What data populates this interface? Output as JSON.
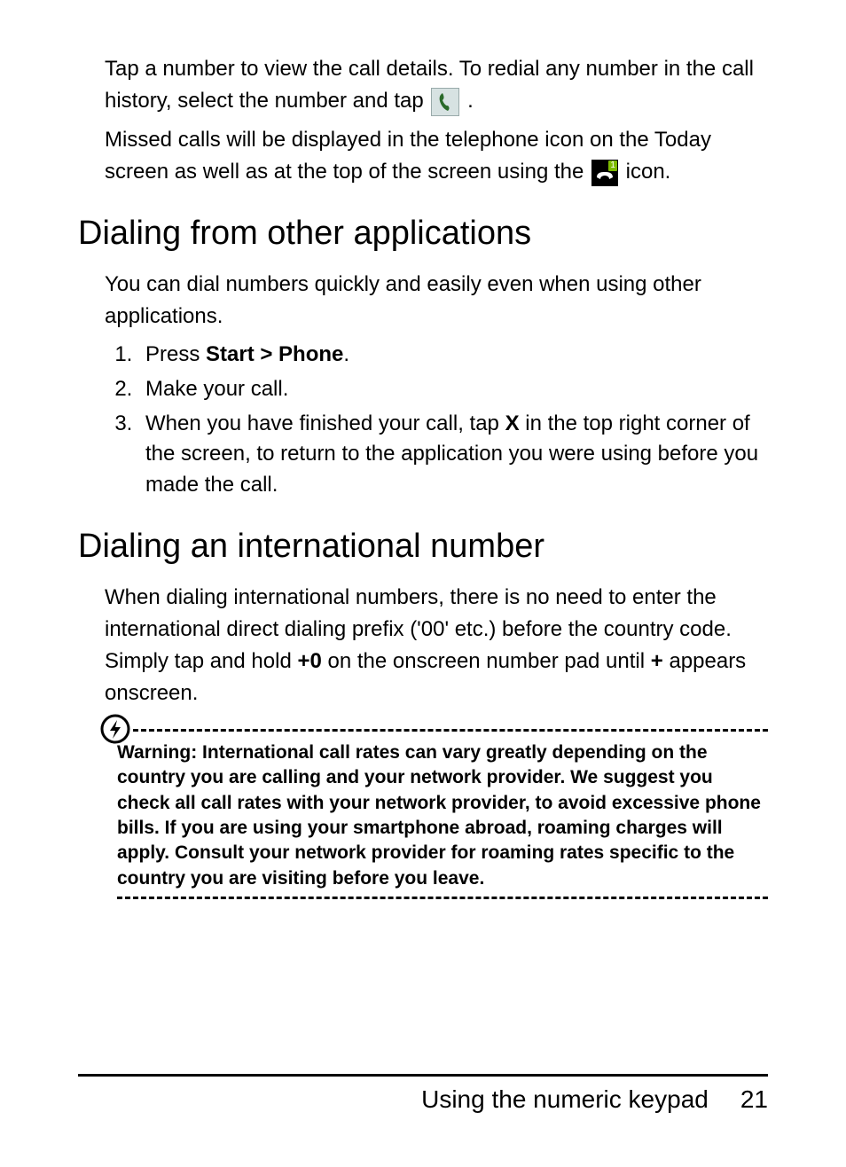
{
  "intro": {
    "p1a": "Tap a number to view the call details. To redial any number in the call history, select the number and tap ",
    "p1b": ".",
    "p2a": "Missed calls will be displayed in the telephone icon on the Today screen as well as at the top of the screen using the ",
    "p2b": " icon."
  },
  "section1": {
    "heading": "Dialing from other applications",
    "lead": "You can dial numbers quickly and easily even when using other applications.",
    "steps": {
      "s1a": "Press ",
      "s1b": "Start > Phone",
      "s1c": ".",
      "s2": "Make your call.",
      "s3a": "When you have finished your call, tap ",
      "s3b": "X",
      "s3c": " in the top right corner of the screen, to return to the application you were using before you made the call."
    }
  },
  "section2": {
    "heading": "Dialing an international number",
    "p1a": "When dialing international numbers, there is no need to enter the international direct dialing prefix ('00' etc.) before the country code. Simply tap and hold ",
    "p1b": "+0",
    "p1c": " on the onscreen number pad until ",
    "p1d": "+",
    "p1e": " appears onscreen."
  },
  "warning": {
    "text": "Warning: International call rates can vary greatly depending on the country you are calling and your network provider. We suggest you check all call rates with your network provider, to avoid excessive phone bills. If you are using your smartphone abroad, roaming charges will apply. Consult your network provider for roaming rates specific to the country you are visiting before you leave."
  },
  "footer": {
    "title": "Using the numeric keypad",
    "page": "21"
  },
  "missed_badge": "1"
}
